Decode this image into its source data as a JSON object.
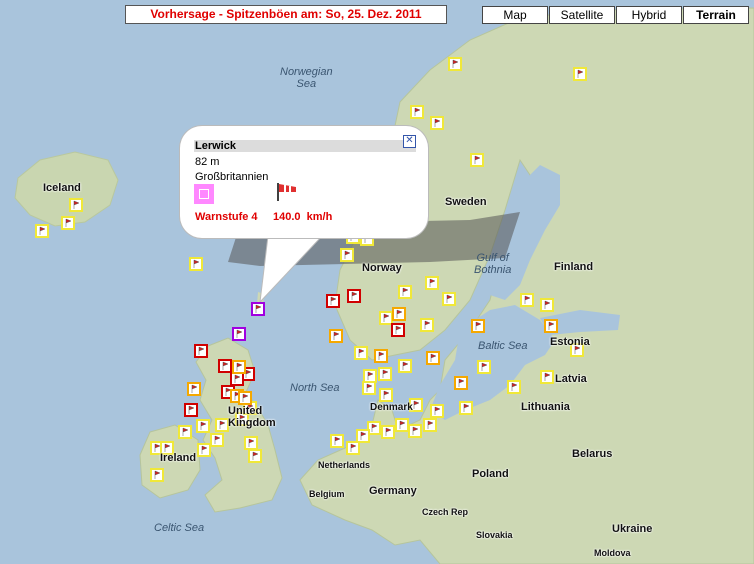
{
  "forecast_title": "Vorhersage - Spitzenböen am: So, 25. Dez. 2011",
  "map_types": [
    {
      "label": "Map",
      "selected": false
    },
    {
      "label": "Satellite",
      "selected": false
    },
    {
      "label": "Hybrid",
      "selected": false
    },
    {
      "label": "Terrain",
      "selected": true
    }
  ],
  "popup": {
    "station": "Lerwick",
    "altitude": "82 m",
    "country": "Großbritannien",
    "warning": "Warnstufe 4",
    "gust": "140.0",
    "unit": "km/h",
    "close_symbol": "✕",
    "warn_color": "#ff88ff",
    "wind_icon": "windsock-icon"
  },
  "warning_colors": {
    "level1": "#f0e838",
    "level2": "#f5a800",
    "level3": "#d00000",
    "level4": "#a000e0"
  },
  "country_labels": [
    "Iceland",
    "Sweden",
    "Norway",
    "Finland",
    "Estonia",
    "Latvia",
    "Lithuania",
    "Belarus",
    "Poland",
    "Germany",
    "Netherlands",
    "Belgium",
    "Ireland",
    "United Kingdom",
    "Denmark",
    "Czech Rep",
    "Slovakia",
    "Ukraine",
    "Moldova"
  ],
  "sea_labels": [
    "Norwegian Sea",
    "Gulf of Bothnia",
    "Baltic Sea",
    "North Sea",
    "Celtic Sea"
  ],
  "label_text": {
    "iceland": "Iceland",
    "sweden": "Sweden",
    "norway": "Norway",
    "finland": "Finland",
    "estonia": "Estonia",
    "latvia": "Latvia",
    "lithuania": "Lithuania",
    "belarus": "Belarus",
    "poland": "Poland",
    "germany": "Germany",
    "netherlands": "Netherlands",
    "belgium": "Belgium",
    "ireland": "Ireland",
    "uk1": "United",
    "uk2": "Kingdom",
    "denmark": "Denmark",
    "czech": "Czech Rep",
    "slovakia": "Slovakia",
    "ukraine": "Ukraine",
    "moldova": "Moldova",
    "norwegian_sea1": "Norwegian",
    "norwegian_sea2": "Sea",
    "bothnia1": "Gulf of",
    "bothnia2": "Bothnia",
    "baltic": "Baltic Sea",
    "north_sea": "North Sea",
    "celtic": "Celtic Sea"
  },
  "stations": [
    {
      "level": 1
    },
    {
      "level": 1
    },
    {
      "level": 1
    },
    {
      "level": 1
    },
    {
      "level": 1
    },
    {
      "level": 4
    },
    {
      "level": 4
    },
    {
      "level": 3
    },
    {
      "level": 3
    },
    {
      "level": 3
    }
  ]
}
